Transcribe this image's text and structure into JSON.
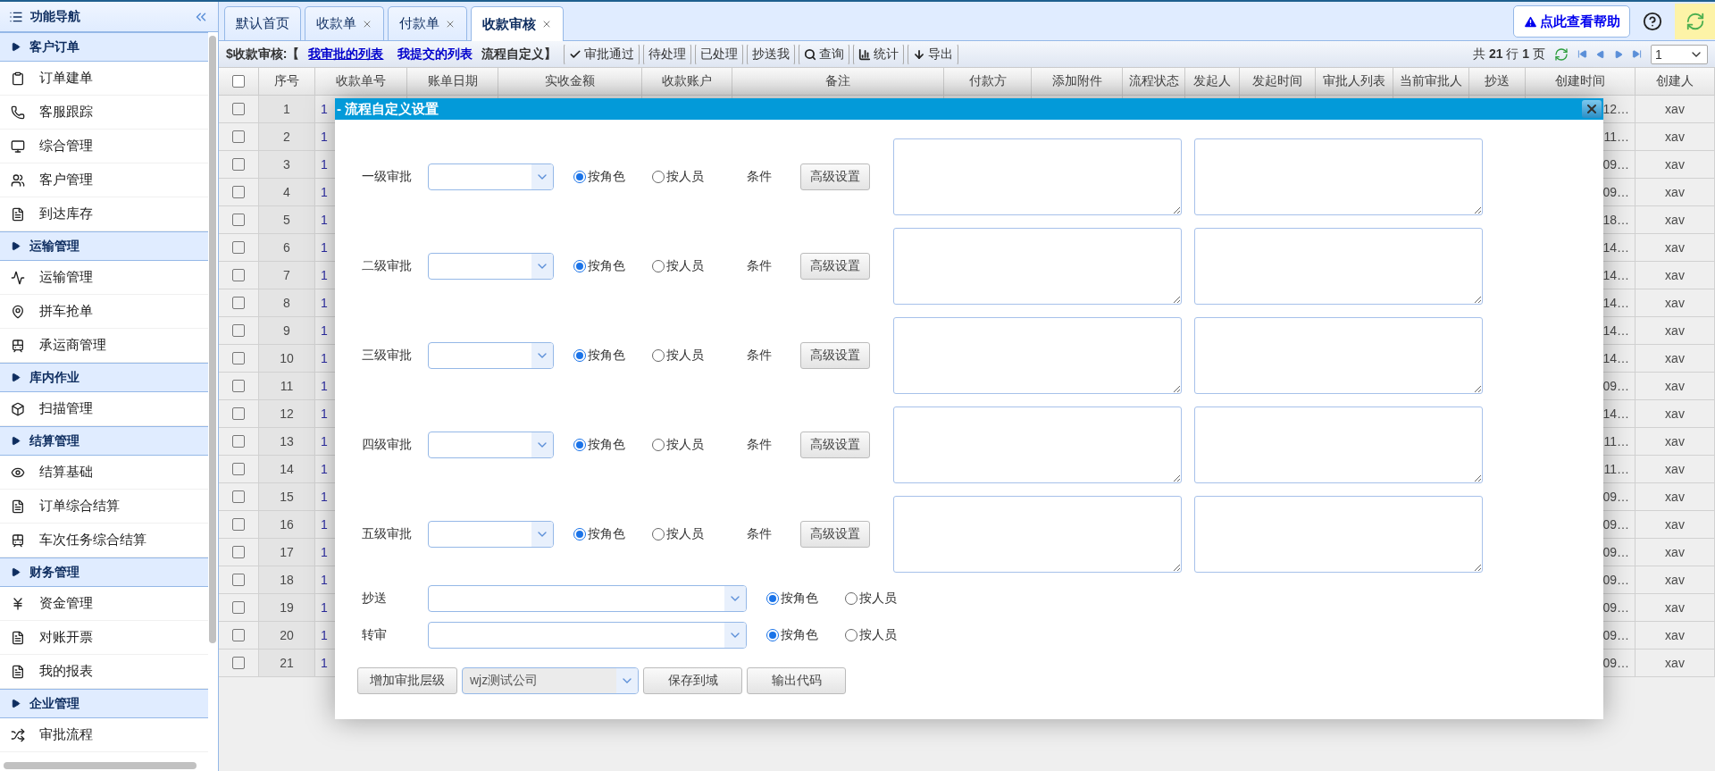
{
  "sidebar": {
    "title": "功能导航",
    "groups": [
      {
        "title": "客户订单",
        "items": [
          {
            "label": "订单建单"
          },
          {
            "label": "客服跟踪"
          },
          {
            "label": "综合管理"
          },
          {
            "label": "客户管理"
          },
          {
            "label": "到达库存"
          }
        ]
      },
      {
        "title": "运输管理",
        "items": [
          {
            "label": "运输管理"
          },
          {
            "label": "拼车抢单"
          },
          {
            "label": "承运商管理"
          }
        ]
      },
      {
        "title": "库内作业",
        "items": [
          {
            "label": "扫描管理"
          }
        ]
      },
      {
        "title": "结算管理",
        "items": [
          {
            "label": "结算基础"
          },
          {
            "label": "订单综合结算"
          },
          {
            "label": "车次任务综合结算"
          }
        ]
      },
      {
        "title": "财务管理",
        "items": [
          {
            "label": "资金管理"
          },
          {
            "label": "对账开票"
          },
          {
            "label": "我的报表"
          }
        ]
      },
      {
        "title": "企业管理",
        "items": [
          {
            "label": "审批流程"
          }
        ]
      }
    ]
  },
  "tabs": [
    {
      "label": "默认首页",
      "closable": false,
      "selected": false
    },
    {
      "label": "收款单",
      "closable": true,
      "selected": false
    },
    {
      "label": "付款单",
      "closable": true,
      "selected": false
    },
    {
      "label": "收款审核",
      "closable": true,
      "selected": true
    }
  ],
  "help": {
    "label": "点此查看帮助"
  },
  "toolbar": {
    "title": "$收款审核:【",
    "links": [
      {
        "label": "我审批的列表",
        "selected": true
      },
      {
        "label": "我提交的列表",
        "selected": false
      }
    ],
    "suffix": "流程自定义】",
    "buttons": [
      {
        "label": "审批通过",
        "kind": "check"
      },
      {
        "label": "待处理",
        "kind": "plain"
      },
      {
        "label": "已处理",
        "kind": "plain"
      },
      {
        "label": "抄送我",
        "kind": "plain"
      },
      {
        "label": "查询",
        "kind": "search"
      },
      {
        "label": "统计",
        "kind": "chart"
      },
      {
        "label": "导出",
        "kind": "download"
      }
    ],
    "pager_summary": "共 **21** 行 **1** 页",
    "page": "1"
  },
  "table": {
    "columns": [
      "序号",
      "收款单号",
      "账单日期",
      "实收金额",
      "收款账户",
      "备注",
      "付款方",
      "添加附件",
      "流程状态",
      "发起人",
      "发起时间",
      "审批人列表",
      "当前审批人",
      "抄送",
      "创建时间",
      "创建人"
    ],
    "header_checked": false,
    "rows": [
      {
        "seq": "1",
        "checked": false,
        "order_no": "1",
        "created": "12…",
        "creator": "xav"
      },
      {
        "seq": "2",
        "checked": false,
        "order_no": "1",
        "created": "11…",
        "creator": "xav"
      },
      {
        "seq": "3",
        "checked": false,
        "order_no": "1",
        "created": "09…",
        "creator": "xav"
      },
      {
        "seq": "4",
        "checked": false,
        "order_no": "1",
        "created": "09…",
        "creator": "xav"
      },
      {
        "seq": "5",
        "checked": false,
        "order_no": "1",
        "created": "18…",
        "creator": "xav"
      },
      {
        "seq": "6",
        "checked": false,
        "order_no": "1",
        "created": "14…",
        "creator": "xav"
      },
      {
        "seq": "7",
        "checked": false,
        "order_no": "1",
        "created": "14…",
        "creator": "xav"
      },
      {
        "seq": "8",
        "checked": false,
        "order_no": "1",
        "created": "14…",
        "creator": "xav"
      },
      {
        "seq": "9",
        "checked": false,
        "order_no": "1",
        "created": "14…",
        "creator": "xav"
      },
      {
        "seq": "10",
        "checked": false,
        "order_no": "1",
        "created": "14…",
        "creator": "xav"
      },
      {
        "seq": "11",
        "checked": false,
        "order_no": "1",
        "created": "09…",
        "creator": "xav"
      },
      {
        "seq": "12",
        "checked": false,
        "order_no": "1",
        "created": "14…",
        "creator": "xav"
      },
      {
        "seq": "13",
        "checked": false,
        "order_no": "1",
        "created": "11…",
        "creator": "xav"
      },
      {
        "seq": "14",
        "checked": false,
        "order_no": "1",
        "created": "11…",
        "creator": "xav"
      },
      {
        "seq": "15",
        "checked": false,
        "order_no": "1",
        "created": "09…",
        "creator": "xav"
      },
      {
        "seq": "16",
        "checked": false,
        "order_no": "1",
        "created": "09…",
        "creator": "xav"
      },
      {
        "seq": "17",
        "checked": false,
        "order_no": "1",
        "created": "09…",
        "creator": "xav"
      },
      {
        "seq": "18",
        "checked": false,
        "order_no": "1",
        "created": "09…",
        "creator": "xav"
      },
      {
        "seq": "19",
        "checked": false,
        "order_no": "1",
        "created": "09…",
        "creator": "xav"
      },
      {
        "seq": "20",
        "checked": false,
        "order_no": "1",
        "created": "09…",
        "creator": "xav"
      },
      {
        "seq": "21",
        "checked": false,
        "order_no": "1",
        "created": "09…",
        "creator": "xav"
      }
    ]
  },
  "dialog": {
    "title": "- 流程自定义设置",
    "levels": [
      {
        "label": "一级审批",
        "options": [
          {
            "label": "按角色",
            "selected": true
          },
          {
            "label": "按人员",
            "selected": false
          }
        ],
        "condition": "条件",
        "button": "高级设置"
      },
      {
        "label": "二级审批",
        "options": [
          {
            "label": "按角色",
            "selected": true
          },
          {
            "label": "按人员",
            "selected": false
          }
        ],
        "condition": "条件",
        "button": "高级设置"
      },
      {
        "label": "三级审批",
        "options": [
          {
            "label": "按角色",
            "selected": true
          },
          {
            "label": "按人员",
            "selected": false
          }
        ],
        "condition": "条件",
        "button": "高级设置"
      },
      {
        "label": "四级审批",
        "options": [
          {
            "label": "按角色",
            "selected": true
          },
          {
            "label": "按人员",
            "selected": false
          }
        ],
        "condition": "条件",
        "button": "高级设置"
      },
      {
        "label": "五级审批",
        "options": [
          {
            "label": "按角色",
            "selected": true
          },
          {
            "label": "按人员",
            "selected": false
          }
        ],
        "condition": "条件",
        "button": "高级设置"
      }
    ],
    "extra_rows": [
      {
        "label": "抄送",
        "options": [
          {
            "label": "按角色",
            "selected": true
          },
          {
            "label": "按人员",
            "selected": false
          }
        ]
      },
      {
        "label": "转审",
        "options": [
          {
            "label": "按角色",
            "selected": true
          },
          {
            "label": "按人员",
            "selected": false
          }
        ]
      }
    ],
    "footer": {
      "add_button": "增加审批层级",
      "company": "wjz测试公司",
      "save_button": "保存到域",
      "export_button": "输出代码"
    }
  }
}
